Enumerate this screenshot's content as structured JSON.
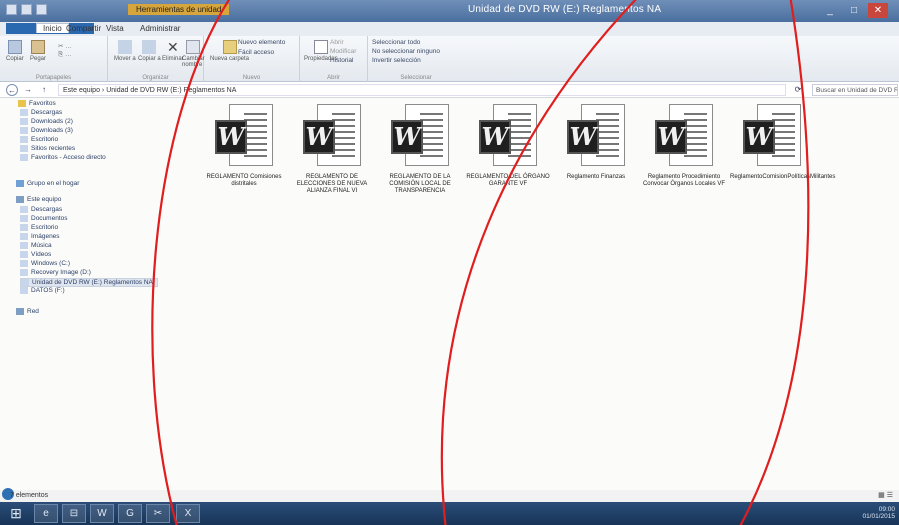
{
  "window": {
    "tools_label": "Herramientas de unidad",
    "title": "Unidad de DVD RW (E:) Reglamentos NA",
    "controls": [
      "_",
      "□",
      "✕"
    ]
  },
  "ribbon_tabs": [
    {
      "label": "Archivo",
      "kind": "file"
    },
    {
      "label": "Inicio",
      "kind": "active"
    },
    {
      "label": "Compartir",
      "kind": "tab"
    },
    {
      "label": "Vista",
      "kind": "tab"
    },
    {
      "label": "Administrar",
      "kind": "tab"
    }
  ],
  "ribbon": {
    "groups": [
      "Portapapeles",
      "Organizar",
      "Nuevo",
      "Abrir",
      "Seleccionar"
    ],
    "buttons": {
      "copy": "Copiar",
      "paste": "Pegar",
      "move_to": "Mover a",
      "copy_to": "Copiar a",
      "delete": "Eliminar",
      "rename": "Cambiar nombre",
      "new_folder": "Nueva carpeta",
      "properties": "Propiedades",
      "new_item": "Nuevo elemento",
      "easy_access": "Fácil acceso",
      "open": "Abrir",
      "edit": "Modificar",
      "history": "Historial",
      "select_all": "Seleccionar todo",
      "select_none": "No seleccionar ninguno",
      "invert": "Invertir selección"
    }
  },
  "address": {
    "path": "Este equipo  ›  Unidad de DVD RW (E:) Reglamentos NA",
    "search_placeholder": "Buscar en Unidad de DVD RW..."
  },
  "nav": {
    "favorites": "Favoritos",
    "fav_items": [
      "Descargas",
      "Downloads (2)",
      "Downloads (3)",
      "Escritorio",
      "Sitios recientes",
      "Favoritos - Acceso directo"
    ],
    "homegroup": "Grupo en el hogar",
    "this_pc": "Este equipo",
    "pc_items": [
      "Descargas",
      "Documentos",
      "Escritorio",
      "Imágenes",
      "Música",
      "Vídeos",
      "Windows (C:)",
      "Recovery Image (D:)",
      "Unidad de DVD RW (E:) Reglamentos NA",
      "DATOS (F:)"
    ],
    "network": "Red"
  },
  "files": [
    {
      "name": "REGLAMENTO Comisiones distritales"
    },
    {
      "name": "REGLAMENTO DE ELECCIONES DE NUEVA ALIANZA FINAL VI"
    },
    {
      "name": "REGLAMENTO DE LA COMISIÓN LOCAL DE TRANSPARENCIA"
    },
    {
      "name": "REGLAMENTO DEL ÓRGANO GARANTE VF"
    },
    {
      "name": "Reglamento Finanzas"
    },
    {
      "name": "Reglamento Procedimiento Convocar Órganos Locales VF"
    },
    {
      "name": "ReglamentoComisionPolíticasMilitantes"
    }
  ],
  "status": {
    "count": "7 elementos"
  },
  "taskbar": {
    "items": [
      "⊞",
      "e",
      "⊟",
      "W",
      "G",
      "✂",
      "X"
    ],
    "tray_time": "09:00",
    "tray_date": "01/01/2015"
  },
  "marker_color": "#e01e1e"
}
